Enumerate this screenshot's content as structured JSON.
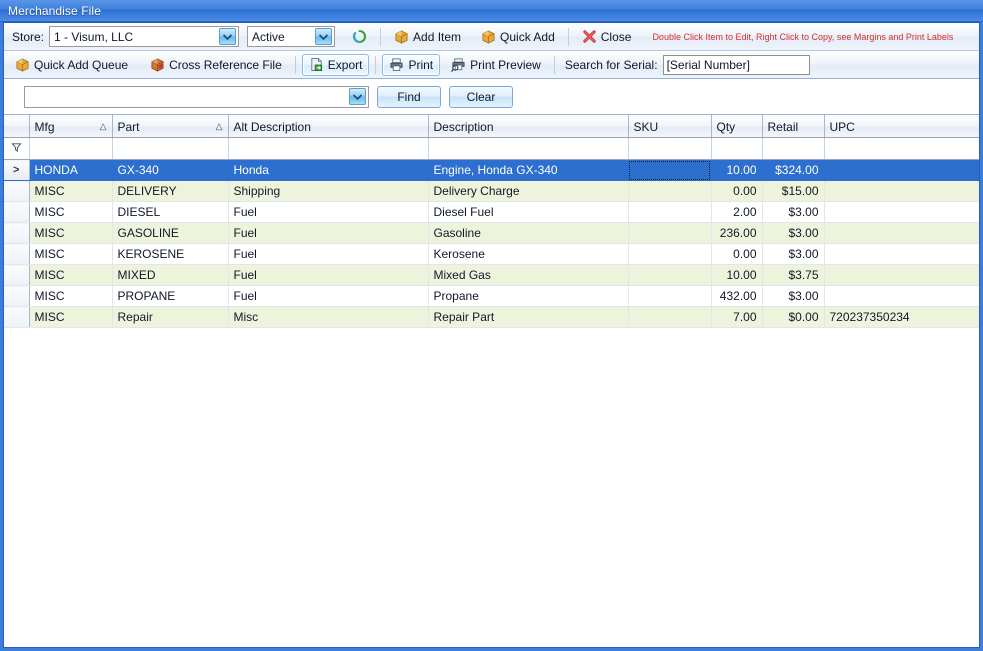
{
  "window": {
    "title": "Merchandise File"
  },
  "toolbar1": {
    "store_label": "Store:",
    "store_value": "1 - Visum, LLC",
    "status_value": "Active",
    "refresh_icon": "refresh-icon",
    "add_item_label": "Add Item",
    "add_item_icon": "box-icon",
    "quick_add_label": "Quick Add",
    "quick_add_icon": "box-icon",
    "close_label": "Close",
    "close_icon": "close-x-icon",
    "hint": "Double Click Item to Edit, Right Click to Copy, see Margins and Print Labels"
  },
  "toolbar2": {
    "quick_add_queue_label": "Quick Add Queue",
    "quick_add_queue_icon": "box-icon",
    "cross_reference_label": "Cross Reference File",
    "cross_reference_icon": "red-box-icon",
    "export_label": "Export",
    "export_icon": "export-icon",
    "print_label": "Print",
    "print_icon": "printer-icon",
    "print_preview_label": "Print Preview",
    "print_preview_icon": "print-preview-icon",
    "search_serial_label": "Search for Serial:",
    "search_serial_value": "[Serial Number]",
    "search_serial_placeholder": "[Serial Number]"
  },
  "findbar": {
    "find_value": "",
    "find_placeholder": "",
    "find_label": "Find",
    "clear_label": "Clear"
  },
  "grid": {
    "filter_icon": "filter-funnel-icon",
    "row_indicator": ">",
    "columns": [
      {
        "key": "mfg",
        "label": "Mfg",
        "sort": "△",
        "align": "left"
      },
      {
        "key": "part",
        "label": "Part",
        "sort": "△",
        "align": "left"
      },
      {
        "key": "alt",
        "label": "Alt Description",
        "sort": "",
        "align": "left"
      },
      {
        "key": "desc",
        "label": "Description",
        "sort": "",
        "align": "left"
      },
      {
        "key": "sku",
        "label": "SKU",
        "sort": "",
        "align": "left"
      },
      {
        "key": "qty",
        "label": "Qty",
        "sort": "",
        "align": "right"
      },
      {
        "key": "retail",
        "label": "Retail",
        "sort": "",
        "align": "right"
      },
      {
        "key": "upc",
        "label": "UPC",
        "sort": "",
        "align": "left"
      }
    ],
    "filter_values": {
      "mfg": "",
      "part": "",
      "alt": "",
      "desc": "",
      "sku": "",
      "qty": "",
      "retail": "",
      "upc": ""
    },
    "rows": [
      {
        "mfg": "HONDA",
        "part": "GX-340",
        "alt": "Honda",
        "desc": "Engine, Honda GX-340",
        "sku": "",
        "qty": "10.00",
        "retail": "$324.00",
        "upc": "",
        "selected": true
      },
      {
        "mfg": "MISC",
        "part": "DELIVERY",
        "alt": "Shipping",
        "desc": "Delivery Charge",
        "sku": "",
        "qty": "0.00",
        "retail": "$15.00",
        "upc": "",
        "selected": false
      },
      {
        "mfg": "MISC",
        "part": "DIESEL",
        "alt": "Fuel",
        "desc": "Diesel Fuel",
        "sku": "",
        "qty": "2.00",
        "retail": "$3.00",
        "upc": "",
        "selected": false
      },
      {
        "mfg": "MISC",
        "part": "GASOLINE",
        "alt": "Fuel",
        "desc": "Gasoline",
        "sku": "",
        "qty": "236.00",
        "retail": "$3.00",
        "upc": "",
        "selected": false
      },
      {
        "mfg": "MISC",
        "part": "KEROSENE",
        "alt": "Fuel",
        "desc": "Kerosene",
        "sku": "",
        "qty": "0.00",
        "retail": "$3.00",
        "upc": "",
        "selected": false
      },
      {
        "mfg": "MISC",
        "part": "MIXED",
        "alt": "Fuel",
        "desc": "Mixed Gas",
        "sku": "",
        "qty": "10.00",
        "retail": "$3.75",
        "upc": "",
        "selected": false
      },
      {
        "mfg": "MISC",
        "part": "PROPANE",
        "alt": "Fuel",
        "desc": "Propane",
        "sku": "",
        "qty": "432.00",
        "retail": "$3.00",
        "upc": "",
        "selected": false
      },
      {
        "mfg": "MISC",
        "part": "Repair",
        "alt": "Misc",
        "desc": "Repair Part",
        "sku": "",
        "qty": "7.00",
        "retail": "$0.00",
        "upc": "720237350234",
        "selected": false
      }
    ],
    "focused_cell": {
      "row": 0,
      "column": "sku"
    }
  },
  "colors": {
    "title_bar": "#3f7fdc",
    "window_border": "#1f5fc4",
    "selection": "#2d6fcf",
    "alt_row": "#eef4dc",
    "hint_red": "#d62f2f"
  }
}
